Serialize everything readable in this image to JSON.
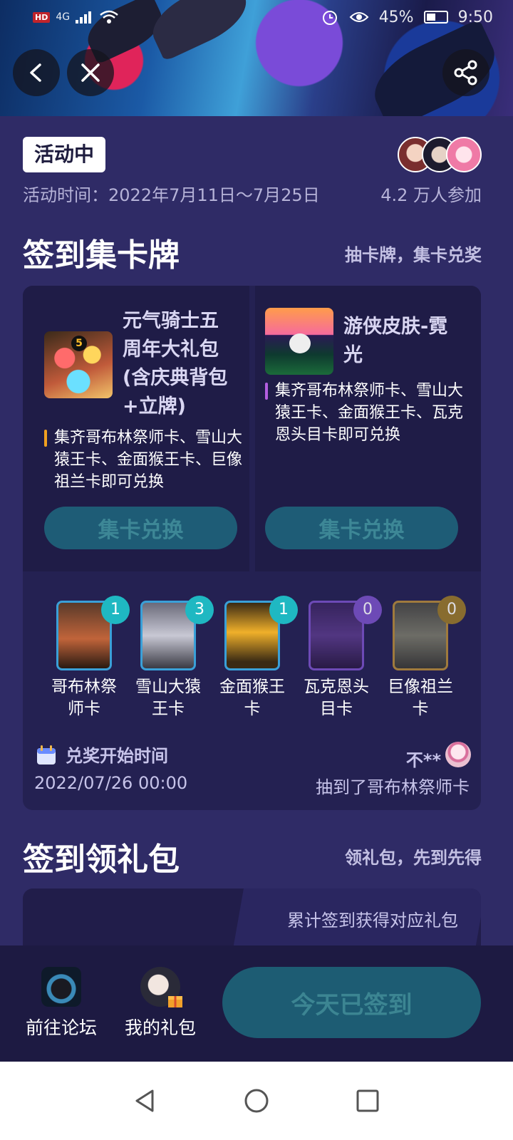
{
  "status_bar": {
    "hd_label": "HD",
    "network_label": "4G",
    "battery_percent": "45%",
    "time": "9:50"
  },
  "header": {
    "status_badge": "活动中",
    "activity_time": "活动时间：2022年7月11日～7月25日",
    "participants": "4.2 万人参加"
  },
  "card_section": {
    "title": "签到集卡牌",
    "subtitle": "抽卡牌，集卡兑奖",
    "rewards": [
      {
        "name": "元气骑士五周年大礼包(含庆典背包+立牌)",
        "condition": "集齐哥布林祭师卡、雪山大猿王卡、金面猴王卡、巨像祖兰卡即可兑换",
        "accent_color": "#f0a020",
        "button_label": "集卡兑换",
        "thumb_badge": "5"
      },
      {
        "name": "游侠皮肤-霓光",
        "condition": "集齐哥布林祭师卡、雪山大猿王卡、金面猴王卡、瓦克恩头目卡即可兑换",
        "accent_color": "#b35ee0",
        "button_label": "集卡兑换"
      }
    ],
    "cards": [
      {
        "label": "哥布林祭师卡",
        "count": "1",
        "badge_color": "#1fb8c2",
        "frame_color": "#3aa0d8"
      },
      {
        "label": "雪山大猿王卡",
        "count": "3",
        "badge_color": "#1fb8c2",
        "frame_color": "#3aa0d8"
      },
      {
        "label": "金面猴王卡",
        "count": "1",
        "badge_color": "#1fb8c2",
        "frame_color": "#3aa0d8"
      },
      {
        "label": "瓦克恩头目卡",
        "count": "0",
        "badge_color": "#7a52c8",
        "frame_color": "#7a52c8"
      },
      {
        "label": "巨像祖兰卡",
        "count": "0",
        "badge_color": "#9a7a2a",
        "frame_color": "#b58a3a"
      }
    ],
    "redeem_time_label": "兑奖开始时间",
    "redeem_time": "2022/07/26 00:00",
    "winner_name": "不**",
    "winner_detail": "抽到了哥布林祭师卡"
  },
  "gift_section": {
    "title": "签到领礼包",
    "subtitle": "领礼包，先到先得",
    "description": "累计签到获得对应礼包"
  },
  "bottom_bar": {
    "forum_label": "前往论坛",
    "my_gifts_label": "我的礼包",
    "signin_label": "今天已签到"
  }
}
